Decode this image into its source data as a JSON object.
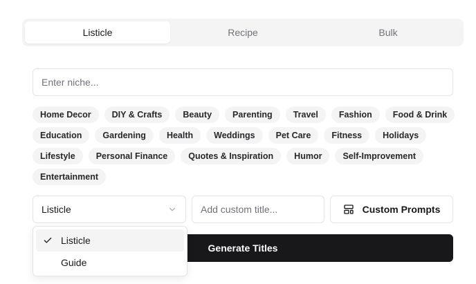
{
  "tabs": [
    {
      "label": "Listicle",
      "active": true
    },
    {
      "label": "Recipe",
      "active": false
    },
    {
      "label": "Bulk",
      "active": false
    }
  ],
  "niche": {
    "placeholder": "Enter niche...",
    "value": ""
  },
  "niche_chips": [
    "Home Decor",
    "DIY & Crafts",
    "Beauty",
    "Parenting",
    "Travel",
    "Fashion",
    "Food & Drink",
    "Education",
    "Gardening",
    "Health",
    "Weddings",
    "Pet Care",
    "Fitness",
    "Holidays",
    "Lifestyle",
    "Personal Finance",
    "Quotes & Inspiration",
    "Humor",
    "Self-Improvement",
    "Entertainment"
  ],
  "type_select": {
    "selected": "Listicle",
    "options": [
      {
        "label": "Listicle",
        "selected": true
      },
      {
        "label": "Guide",
        "selected": false
      }
    ]
  },
  "custom_title": {
    "placeholder": "Add custom title...",
    "value": ""
  },
  "custom_prompts": {
    "label": "Custom Prompts",
    "icon": "layout-template-icon"
  },
  "generate": {
    "label": "Generate Titles"
  },
  "colors": {
    "primary": "#18181b",
    "muted_bg": "#f4f4f5",
    "border": "#e4e4e7",
    "muted_text": "#71717a"
  }
}
